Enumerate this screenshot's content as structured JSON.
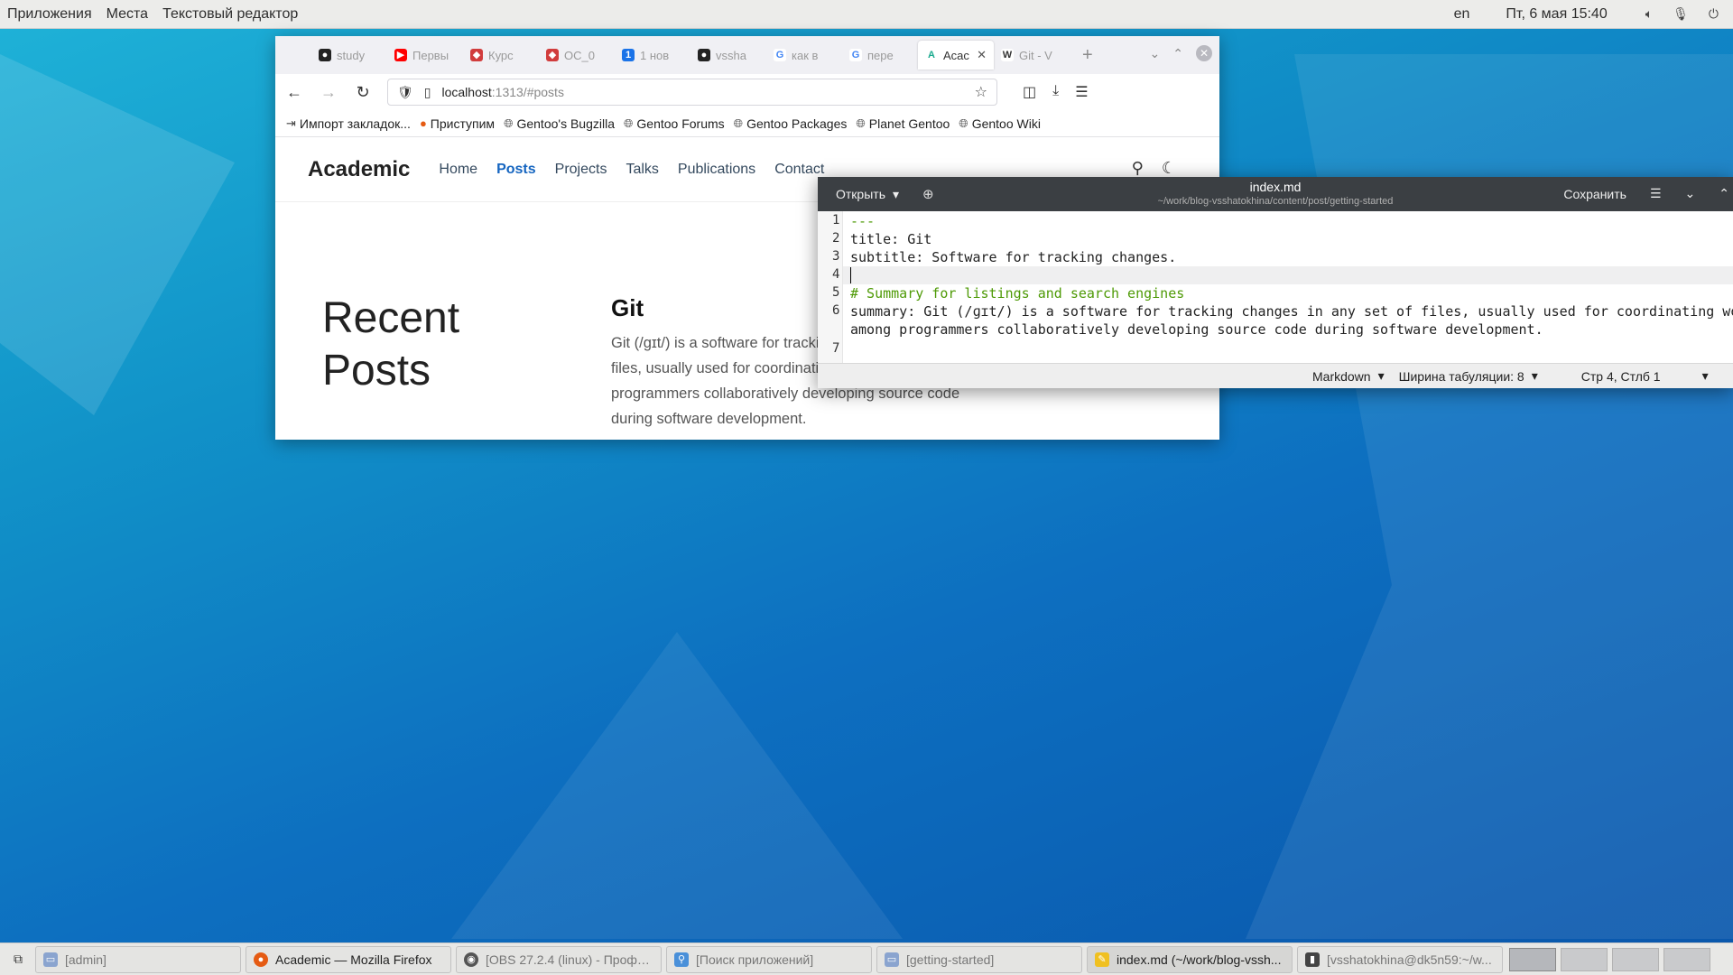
{
  "top_panel": {
    "menus": [
      "Приложения",
      "Места",
      "Текстовый редактор"
    ],
    "keyboard_layout": "en",
    "datetime": "Пт, 6 мая  15:40",
    "icons": [
      "volume-icon",
      "microphone-icon",
      "power-icon"
    ]
  },
  "firefox": {
    "tabs": [
      {
        "label": "study",
        "icon": "github-icon",
        "color": "#222222"
      },
      {
        "label": "Первы",
        "icon": "youtube-icon",
        "color": "#ff0000"
      },
      {
        "label": "Курс",
        "icon": "course-icon",
        "color": "#d13c3c"
      },
      {
        "label": "ОС_0",
        "icon": "course-icon",
        "color": "#d13c3c"
      },
      {
        "label": "1 нов",
        "icon": "notification-icon",
        "color": "#1a73e8"
      },
      {
        "label": "vssha",
        "icon": "github-icon",
        "color": "#222222"
      },
      {
        "label": "как в",
        "icon": "google-icon",
        "color": "#4285f4"
      },
      {
        "label": "пере",
        "icon": "google-icon",
        "color": "#4285f4"
      },
      {
        "label": "Acac",
        "icon": "academic-icon",
        "color": "#1aaa8e",
        "active": true
      },
      {
        "label": "Git - V",
        "icon": "wikipedia-icon",
        "color": "#333333"
      }
    ],
    "url_host": "localhost",
    "url_path": ":1313/#posts",
    "bookmarks": [
      {
        "label": "Импорт закладок...",
        "icon": "import-icon"
      },
      {
        "label": "Приступим",
        "icon": "firefox-icon"
      },
      {
        "label": "Gentoo's Bugzilla",
        "icon": "globe-icon"
      },
      {
        "label": "Gentoo Forums",
        "icon": "globe-icon"
      },
      {
        "label": "Gentoo Packages",
        "icon": "globe-icon"
      },
      {
        "label": "Planet Gentoo",
        "icon": "globe-icon"
      },
      {
        "label": "Gentoo Wiki",
        "icon": "globe-icon"
      }
    ]
  },
  "site": {
    "brand": "Academic",
    "nav": [
      {
        "label": "Home"
      },
      {
        "label": "Posts",
        "active": true
      },
      {
        "label": "Projects"
      },
      {
        "label": "Talks"
      },
      {
        "label": "Publications"
      },
      {
        "label": "Contact"
      }
    ],
    "section_title": "Recent Posts",
    "post_title": "Git",
    "post_summary": "Git (/ɡɪt/) is a software for tracking changes in any set of files, usually used for coordinating work among programmers collaboratively developing source code during software development."
  },
  "gedit": {
    "open_label": "Открыть",
    "filename": "index.md",
    "path": "~/work/blog-vsshatokhina/content/post/getting-started",
    "save_label": "Сохранить",
    "lines": [
      {
        "n": "1",
        "text": "---",
        "style": "green"
      },
      {
        "n": "2",
        "text": "title: Git",
        "style": "plain"
      },
      {
        "n": "3",
        "text": "subtitle: Software for tracking changes.",
        "style": "plain"
      },
      {
        "n": "4",
        "text": "",
        "style": "plain"
      },
      {
        "n": "5",
        "text": "# Summary for listings and search engines",
        "style": "green"
      },
      {
        "n": "6",
        "text": "summary: Git (/ɡɪt/) is a software for tracking changes in any set of files, usually used for coordinating wo",
        "style": "plain"
      },
      {
        "n": "",
        "text": "among programmers collaboratively developing source code during software development.",
        "style": "plain"
      },
      {
        "n": "7",
        "text": "",
        "style": "plain"
      }
    ],
    "language": "Markdown",
    "tab_width": "Ширина табуляции: 8",
    "cursor_position": "Стр 4, Стлб 1"
  },
  "taskbar": {
    "tasks": [
      {
        "label": "[admin]",
        "icon": "folder-icon",
        "color": "#8aa4cf"
      },
      {
        "label": "Academic — Mozilla Firefox",
        "icon": "firefox-icon",
        "color": "#e55b13",
        "focused": true
      },
      {
        "label": "[OBS 27.2.4 (linux) - Профил...",
        "icon": "obs-icon",
        "color": "#555555"
      },
      {
        "label": "[Поиск приложений]",
        "icon": "search-icon",
        "color": "#4a90d9"
      },
      {
        "label": "[getting-started]",
        "icon": "folder-icon",
        "color": "#8aa4cf"
      },
      {
        "label": "index.md (~/work/blog-vssh...",
        "icon": "text-editor-icon",
        "color": "#f0c020",
        "active": true
      },
      {
        "label": "[vsshatokhina@dk5n59:~/w...",
        "icon": "terminal-icon",
        "color": "#444444"
      }
    ],
    "workspaces": 4
  }
}
